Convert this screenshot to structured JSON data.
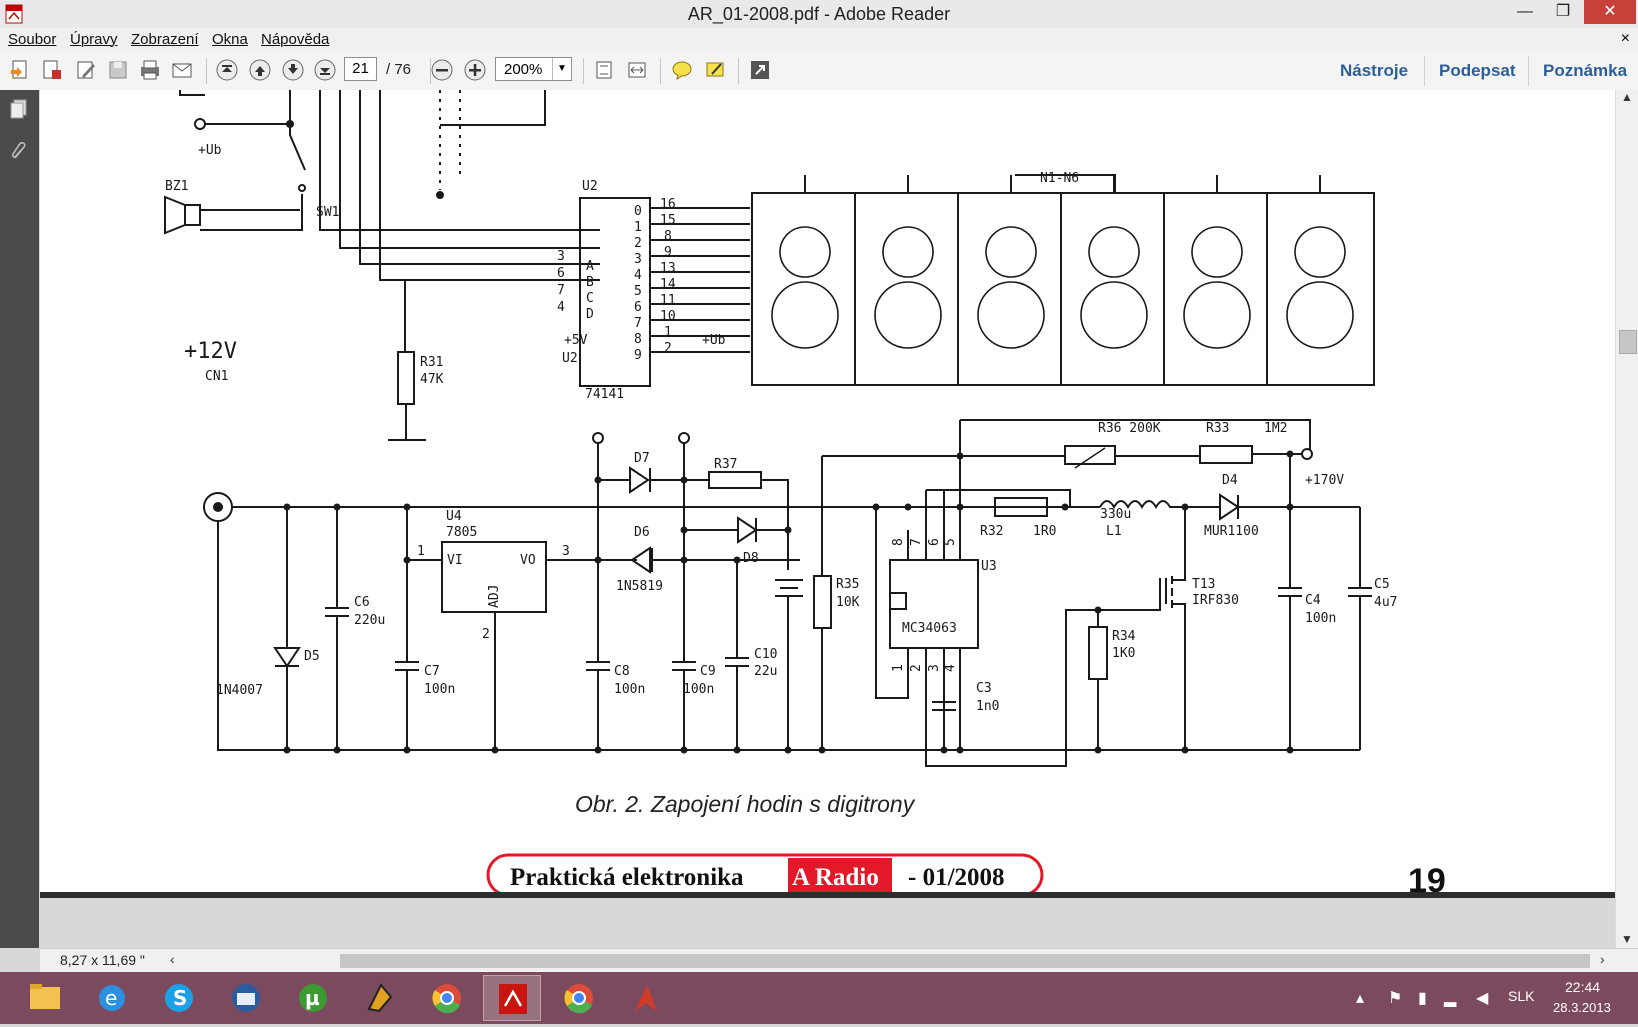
{
  "window": {
    "title": "AR_01-2008.pdf - Adobe Reader",
    "min_icon": "minimize-icon",
    "max_icon": "maximize-icon",
    "close_icon": "close-icon",
    "min_glyph": "—",
    "max_glyph": "❐",
    "close_glyph": "✕"
  },
  "menu": {
    "items": [
      "Soubor",
      "Úpravy",
      "Zobrazení",
      "Okna",
      "Nápověda"
    ],
    "close_glyph": "×"
  },
  "toolbar": {
    "page_current": "21",
    "page_total": "/ 76",
    "zoom": "200%",
    "zoom_arrow": "▼",
    "links": [
      "Nástroje",
      "Podepsat",
      "Poznámka"
    ]
  },
  "document": {
    "schematic_labels": {
      "u2": "U2",
      "u2_ic": "74141",
      "pins_left": [
        "3",
        "6",
        "7",
        "4"
      ],
      "inputs": [
        "A",
        "B",
        "C",
        "D"
      ],
      "pins_right": [
        "16",
        "15",
        "8",
        "9",
        "13",
        "14",
        "11",
        "10",
        "1",
        "2"
      ],
      "outputs": [
        "0",
        "1",
        "2",
        "3",
        "4",
        "5",
        "6",
        "7",
        "8",
        "9"
      ],
      "n1n6": "N1-N6",
      "ub": "+Ub",
      "bz1": "BZ1",
      "sw1": "SW1",
      "r31": "R31",
      "r31v": "47K",
      "v12": "+12V",
      "cn1": "CN1",
      "plus5v": "+5V",
      "u2b": "U2",
      "ub2": "+Ub",
      "d7": "D7",
      "r37": "R37",
      "u4": "U4",
      "u4ic": "7805",
      "vi": "VI",
      "vo": "VO",
      "adj": "ADJ",
      "pin1": "1",
      "pin3": "3",
      "pin2": "2",
      "d6": "D6",
      "d6v": "1N5819",
      "d8": "D8",
      "c6": "C6",
      "c6v": "220u",
      "d5": "D5",
      "d5v": "1N4007",
      "c7": "C7",
      "c7v": "100n",
      "c8": "C8",
      "c8v": "100n",
      "c9": "C9",
      "c9v": "100n",
      "c10": "C10",
      "c10v": "22u",
      "r35": "R35",
      "r35v": "10K",
      "r36": "R36 200K",
      "r33": "R33",
      "r33v": "1M2",
      "v170": "+170V",
      "r32": "R32",
      "r32v": "1R0",
      "l1v": "330u",
      "l1": "L1",
      "d4": "D4",
      "d4v": "MUR1100",
      "u3": "U3",
      "u3ic": "MC34063",
      "pins_top": [
        "8",
        "7",
        "6",
        "5"
      ],
      "pins_bottom": [
        "1",
        "2",
        "3",
        "4"
      ],
      "c3": "C3",
      "c3v": "1n0",
      "t13": "T13",
      "t13v": "IRF830",
      "r34": "R34",
      "r34v": "1K0",
      "c4": "C4",
      "c4v": "100n",
      "c5": "C5",
      "c5v": "4u7"
    },
    "caption": "Obr. 2. Zapojení hodin s digitrony",
    "banner": {
      "part1": "Praktická elektronika",
      "part2": "A Radio",
      "part3": "- 01/2008"
    },
    "page_number": "19"
  },
  "scrollbars": {
    "up": "▲",
    "down": "▼",
    "left": "‹",
    "right": "›"
  },
  "status": {
    "page_size": "8,27 x 11,69 \""
  },
  "taskbar": {
    "apps": [
      "file-explorer-icon",
      "internet-explorer-icon",
      "skype-icon",
      "thunderbird-icon",
      "utorrent-icon",
      "winamp-icon",
      "chrome-icon",
      "adobe-reader-icon",
      "chrome-icon",
      "app-icon"
    ],
    "tray_lang": "SLK",
    "time": "22:44",
    "date": "28.3.2013"
  },
  "colors": {
    "taskbar": "#7c4a5e",
    "link": "#2c5f9a",
    "banner_red": "#e3192a",
    "panel": "#4b4b4b"
  }
}
